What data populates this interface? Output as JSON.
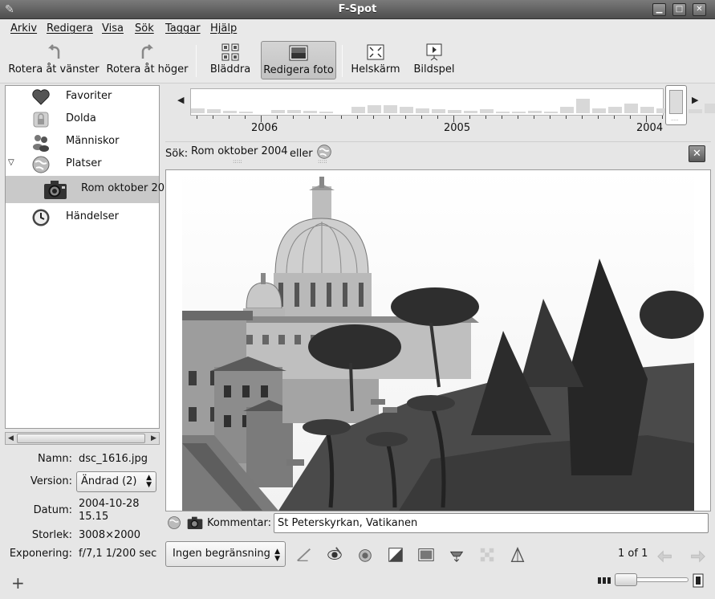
{
  "window": {
    "title": "F-Spot"
  },
  "menu": [
    "Arkiv",
    "Redigera",
    "Visa",
    "Sök",
    "Taggar",
    "Hjälp"
  ],
  "toolbar": {
    "rotate_left": "Rotera åt vänster",
    "rotate_right": "Rotera åt höger",
    "browse": "Bläddra",
    "edit_photo": "Redigera foto",
    "fullscreen": "Helskärm",
    "slideshow": "Bildspel"
  },
  "sidebar": {
    "items": [
      {
        "label": "Favoriter",
        "icon": "heart-icon"
      },
      {
        "label": "Dolda",
        "icon": "lock-icon"
      },
      {
        "label": "Människor",
        "icon": "people-icon"
      },
      {
        "label": "Platser",
        "icon": "globe-icon",
        "expanded": true
      },
      {
        "label": "Rom oktober 20",
        "icon": "camera-icon",
        "selected": true
      },
      {
        "label": "Händelser",
        "icon": "clock-icon"
      }
    ]
  },
  "info": {
    "name_label": "Namn:",
    "name_value": "dsc_1616.jpg",
    "version_label": "Version:",
    "version_value": "Ändrad (2)",
    "date_label": "Datum:",
    "date_value_1": "2004-10-28",
    "date_value_2": "15.15",
    "size_label": "Storlek:",
    "size_value": "3008×2000",
    "exposure_label": "Exponering:",
    "exposure_value": "f/7,1 1/200 sec"
  },
  "timeline": {
    "years": [
      "2006",
      "2005",
      "2004"
    ]
  },
  "search": {
    "label": "Sök:",
    "term": "Rom oktober 2004",
    "or_label": "eller"
  },
  "comment": {
    "label": "Kommentar:",
    "value": "St Peterskyrkan, Vatikanen"
  },
  "bottom": {
    "limit_value": "Ingen begränsning",
    "pager": "1 of 1"
  },
  "colors": {
    "selection": "#c9c9c9",
    "title_bar": "#5a5a5a"
  }
}
